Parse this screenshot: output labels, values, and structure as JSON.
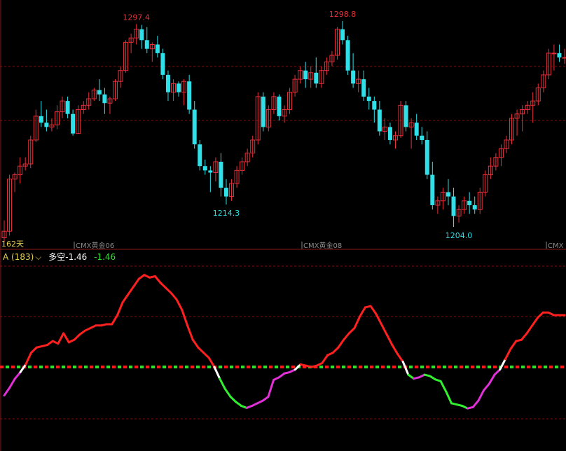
{
  "colors": {
    "up": "#e8303a",
    "down": "#2fe0e8",
    "grid": "#7a1010",
    "separator": "#8a1a1a",
    "ind_red": "#ff2020",
    "ind_magenta": "#e030d8",
    "ind_green": "#30f030",
    "zero_green": "#30e030",
    "zero_red": "#ff1a1a",
    "label_yellow": "#e8d050",
    "hdr_green": "#30e030"
  },
  "price_labels": {
    "high1": "1297.4",
    "high2": "1298.8",
    "low1": "1214.3",
    "low2": "1204.0",
    "days": "162天"
  },
  "contracts": [
    "CMX黄金06",
    "CMX黄金08",
    "CMX"
  ],
  "indicator_header": {
    "name": "A (183)",
    "chevron": "⌵",
    "label": "多空",
    "value_white": "-1.46",
    "value_green": "-1.46"
  },
  "chart_data": [
    {
      "type": "candlestick",
      "y_scale": "price",
      "candles": [
        [
          1199,
          1207,
          1197,
          1202
        ],
        [
          1202,
          1228,
          1200,
          1226
        ],
        [
          1226,
          1229,
          1220,
          1228
        ],
        [
          1228,
          1236,
          1224,
          1232
        ],
        [
          1232,
          1236,
          1230,
          1233
        ],
        [
          1233,
          1246,
          1231,
          1244
        ],
        [
          1244,
          1258,
          1243,
          1255
        ],
        [
          1255,
          1262,
          1250,
          1252
        ],
        [
          1252,
          1258,
          1248,
          1250
        ],
        [
          1250,
          1254,
          1248,
          1251
        ],
        [
          1251,
          1260,
          1249,
          1257
        ],
        [
          1257,
          1264,
          1254,
          1262
        ],
        [
          1262,
          1264,
          1254,
          1256
        ],
        [
          1256,
          1258,
          1246,
          1247
        ],
        [
          1247,
          1260,
          1247,
          1258
        ],
        [
          1258,
          1262,
          1256,
          1260
        ],
        [
          1260,
          1266,
          1258,
          1263
        ],
        [
          1263,
          1268,
          1262,
          1267
        ],
        [
          1267,
          1272,
          1262,
          1265
        ],
        [
          1265,
          1268,
          1256,
          1261
        ],
        [
          1261,
          1264,
          1256,
          1263
        ],
        [
          1263,
          1272,
          1262,
          1271
        ],
        [
          1271,
          1278,
          1268,
          1276
        ],
        [
          1276,
          1290,
          1275,
          1289
        ],
        [
          1289,
          1293,
          1284,
          1291
        ],
        [
          1291,
          1297.4,
          1288,
          1295
        ],
        [
          1295,
          1297,
          1286,
          1290
        ],
        [
          1290,
          1296,
          1284,
          1286
        ],
        [
          1286,
          1289,
          1280,
          1288
        ],
        [
          1288,
          1292,
          1282,
          1284
        ],
        [
          1284,
          1286,
          1272,
          1274
        ],
        [
          1274,
          1276,
          1262,
          1266
        ],
        [
          1266,
          1272,
          1262,
          1270
        ],
        [
          1270,
          1271,
          1264,
          1266
        ],
        [
          1266,
          1272,
          1260,
          1271
        ],
        [
          1271,
          1274,
          1256,
          1258
        ],
        [
          1258,
          1262,
          1240,
          1242
        ],
        [
          1242,
          1244,
          1230,
          1232
        ],
        [
          1232,
          1235,
          1228,
          1230
        ],
        [
          1230,
          1232,
          1220,
          1229
        ],
        [
          1229,
          1236,
          1225,
          1234
        ],
        [
          1234,
          1238,
          1218,
          1222
        ],
        [
          1222,
          1226,
          1214.3,
          1218
        ],
        [
          1218,
          1226,
          1216,
          1224
        ],
        [
          1224,
          1232,
          1222,
          1230
        ],
        [
          1230,
          1236,
          1228,
          1234
        ],
        [
          1234,
          1240,
          1232,
          1238
        ],
        [
          1238,
          1246,
          1236,
          1244
        ],
        [
          1244,
          1266,
          1242,
          1264
        ],
        [
          1264,
          1266,
          1248,
          1250
        ],
        [
          1250,
          1260,
          1248,
          1258
        ],
        [
          1258,
          1266,
          1256,
          1264
        ],
        [
          1264,
          1265,
          1253,
          1255
        ],
        [
          1255,
          1260,
          1252,
          1258
        ],
        [
          1258,
          1268,
          1256,
          1266
        ],
        [
          1266,
          1274,
          1264,
          1272
        ],
        [
          1272,
          1278,
          1270,
          1276
        ],
        [
          1276,
          1280,
          1268,
          1272
        ],
        [
          1272,
          1278,
          1268,
          1275
        ],
        [
          1275,
          1282,
          1268,
          1270
        ],
        [
          1270,
          1278,
          1268,
          1276
        ],
        [
          1276,
          1282,
          1274,
          1280
        ],
        [
          1280,
          1285,
          1278,
          1283
        ],
        [
          1283,
          1296,
          1281,
          1295
        ],
        [
          1295,
          1298.8,
          1288,
          1290
        ],
        [
          1290,
          1292,
          1274,
          1276
        ],
        [
          1276,
          1284,
          1268,
          1270
        ],
        [
          1270,
          1276,
          1266,
          1272
        ],
        [
          1272,
          1276,
          1262,
          1264
        ],
        [
          1264,
          1268,
          1258,
          1262
        ],
        [
          1262,
          1264,
          1252,
          1258
        ],
        [
          1258,
          1262,
          1246,
          1248
        ],
        [
          1248,
          1254,
          1244,
          1250
        ],
        [
          1250,
          1252,
          1242,
          1244
        ],
        [
          1244,
          1248,
          1240,
          1246
        ],
        [
          1246,
          1262,
          1245,
          1260
        ],
        [
          1260,
          1262,
          1248,
          1250
        ],
        [
          1250,
          1254,
          1240,
          1252
        ],
        [
          1252,
          1256,
          1244,
          1246
        ],
        [
          1246,
          1250,
          1242,
          1244
        ],
        [
          1244,
          1248,
          1226,
          1228
        ],
        [
          1228,
          1234,
          1212,
          1214
        ],
        [
          1214,
          1218,
          1210,
          1216
        ],
        [
          1216,
          1222,
          1212,
          1220
        ],
        [
          1220,
          1226,
          1214,
          1218
        ],
        [
          1218,
          1222,
          1204,
          1209
        ],
        [
          1209,
          1214,
          1206,
          1212
        ],
        [
          1212,
          1218,
          1210,
          1216
        ],
        [
          1216,
          1220,
          1210,
          1214
        ],
        [
          1214,
          1218,
          1210,
          1212
        ],
        [
          1212,
          1222,
          1210,
          1220
        ],
        [
          1220,
          1230,
          1218,
          1228
        ],
        [
          1228,
          1236,
          1226,
          1232
        ],
        [
          1232,
          1238,
          1230,
          1236
        ],
        [
          1236,
          1242,
          1232,
          1240
        ],
        [
          1240,
          1246,
          1238,
          1244
        ],
        [
          1244,
          1256,
          1242,
          1254
        ],
        [
          1254,
          1258,
          1246,
          1256
        ],
        [
          1256,
          1260,
          1248,
          1258
        ],
        [
          1258,
          1262,
          1256,
          1260
        ],
        [
          1260,
          1266,
          1252,
          1262
        ],
        [
          1262,
          1270,
          1260,
          1268
        ],
        [
          1268,
          1276,
          1266,
          1274
        ],
        [
          1274,
          1286,
          1272,
          1284
        ],
        [
          1284,
          1288,
          1276,
          1284
        ],
        [
          1284,
          1288,
          1280,
          1282
        ],
        [
          1282,
          1286,
          1279,
          1282
        ]
      ],
      "annotations": [
        "1297.4",
        "1298.8",
        "1214.3",
        "1204.0"
      ]
    },
    {
      "type": "line",
      "indicator": "多空",
      "series_values": [
        -1.1,
        -0.8,
        -0.45,
        -0.2,
        0.1,
        0.55,
        0.75,
        0.8,
        0.85,
        1.0,
        0.9,
        1.3,
        0.95,
        1.05,
        1.25,
        1.4,
        1.5,
        1.6,
        1.6,
        1.65,
        1.65,
        2.0,
        2.5,
        2.8,
        3.1,
        3.4,
        3.55,
        3.45,
        3.5,
        3.25,
        3.05,
        2.85,
        2.6,
        2.2,
        1.6,
        1.05,
        0.75,
        0.55,
        0.35,
        0.0,
        -0.45,
        -0.85,
        -1.15,
        -1.35,
        -1.5,
        -1.58,
        -1.5,
        -1.4,
        -1.3,
        -1.15,
        -0.5,
        -0.4,
        -0.25,
        -0.2,
        -0.1,
        0.1,
        0.05,
        0.0,
        0.05,
        0.15,
        0.45,
        0.55,
        0.75,
        1.05,
        1.3,
        1.5,
        1.95,
        2.3,
        2.35,
        2.05,
        1.65,
        1.25,
        0.85,
        0.5,
        0.2,
        -0.3,
        -0.45,
        -0.4,
        -0.3,
        -0.35,
        -0.48,
        -0.55,
        -0.95,
        -1.4,
        -1.45,
        -1.5,
        -1.6,
        -1.55,
        -1.3,
        -0.9,
        -0.65,
        -0.3,
        -0.1,
        0.3,
        0.7,
        1.0,
        1.05,
        1.3,
        1.6,
        1.9,
        2.1,
        2.1,
        2.0,
        2.0,
        2.0
      ],
      "zero_line": 0
    }
  ]
}
